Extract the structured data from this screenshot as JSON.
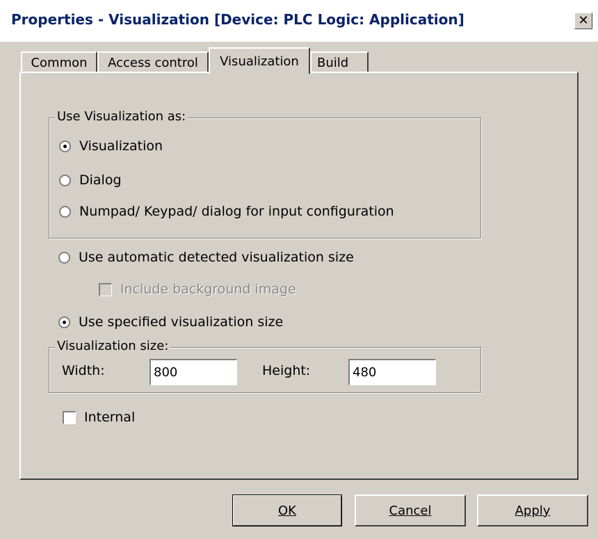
{
  "window": {
    "title": "Properties - Visualization [Device: PLC Logic: Application]",
    "close_glyph": "✕"
  },
  "tabs": [
    {
      "label": "Common",
      "active": false
    },
    {
      "label": "Access control",
      "active": false
    },
    {
      "label": "Visualization",
      "active": true
    },
    {
      "label": "Build",
      "active": false
    }
  ],
  "use_as": {
    "title": "Use Visualization as:",
    "options": [
      {
        "label": "Visualization",
        "checked": true
      },
      {
        "label": "Dialog",
        "checked": false
      },
      {
        "label": "Numpad/ Keypad/ dialog for input configuration",
        "checked": false
      }
    ]
  },
  "size_mode": {
    "auto_label": "Use automatic detected visualization size",
    "auto_checked": false,
    "include_bg_label": "Include background image",
    "include_bg_enabled": false,
    "specified_label": "Use specified visualization size",
    "specified_checked": true
  },
  "vis_size": {
    "title": "Visualization size:",
    "width_label": "Width:",
    "width_value": "800",
    "height_label": "Height:",
    "height_value": "480"
  },
  "internal": {
    "label": "Internal",
    "checked": false
  },
  "buttons": {
    "ok": "OK",
    "cancel": "Cancel",
    "apply": "Apply"
  },
  "colors": {
    "title_text": "#0a246a",
    "dialog_bg": "#d4d0c8"
  }
}
